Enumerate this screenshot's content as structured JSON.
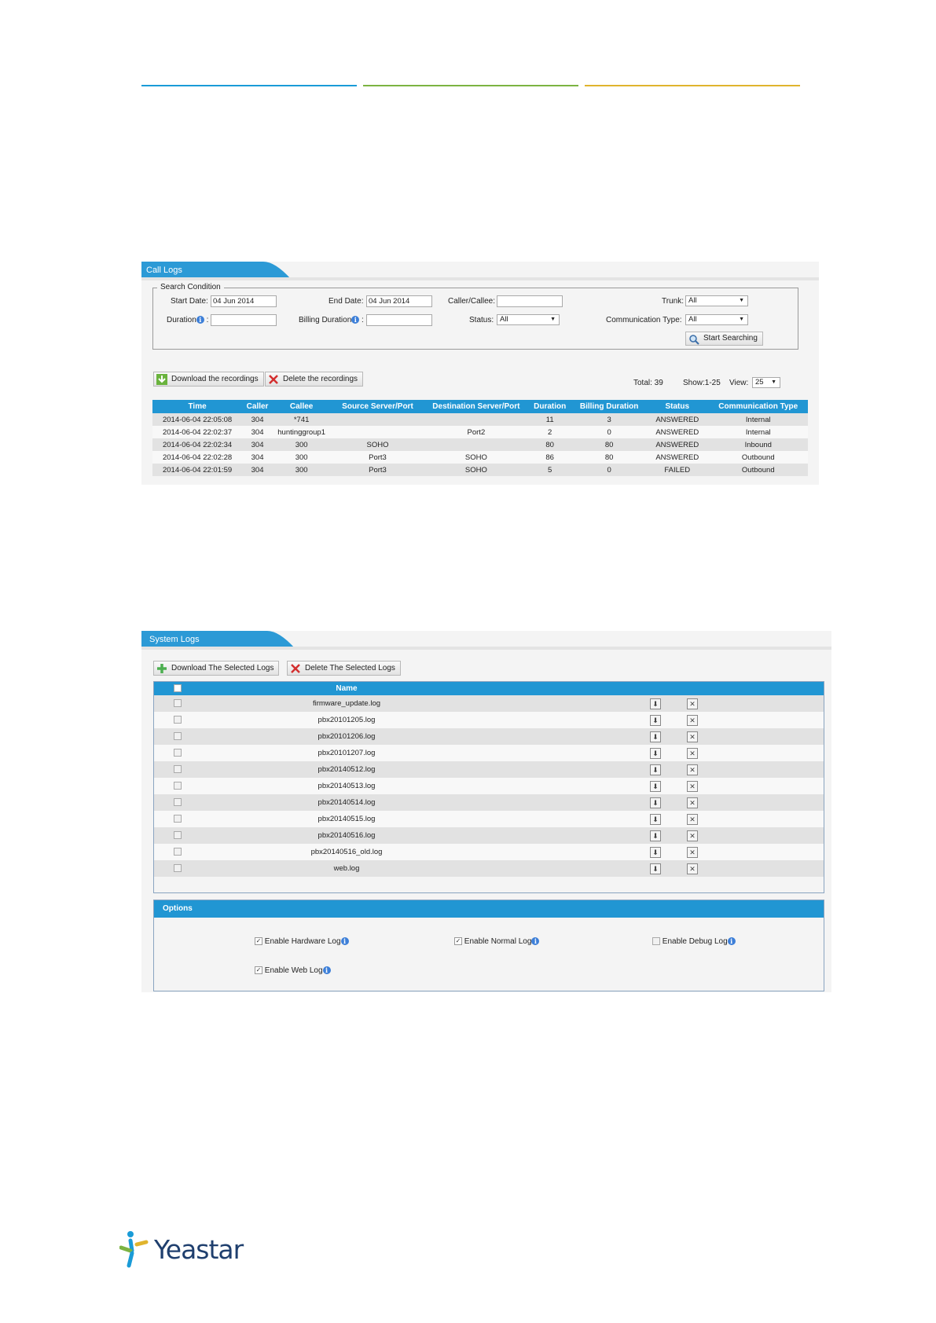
{
  "header": {
    "colors": [
      "#1a9bd7",
      "#7cb342",
      "#e0b42d"
    ]
  },
  "call_logs": {
    "tab_title": "Call Logs",
    "search": {
      "legend": "Search Condition",
      "start_date_label": "Start Date:",
      "start_date_value": "04 Jun 2014",
      "end_date_label": "End Date:",
      "end_date_value": "04 Jun 2014",
      "caller_callee_label": "Caller/Callee:",
      "caller_callee_value": "",
      "trunk_label": "Trunk:",
      "trunk_value": "All",
      "duration_label": "Duration",
      "duration_value": "",
      "billing_duration_label": "Billing Duration",
      "billing_duration_value": "",
      "status_label": "Status:",
      "status_value": "All",
      "comm_type_label": "Communication Type:",
      "comm_type_value": "All",
      "start_searching": "Start Searching"
    },
    "download_recordings": "Download the recordings",
    "delete_recordings": "Delete the recordings",
    "total": "Total: 39",
    "show": "Show:1-25",
    "view_label": "View:",
    "view_value": "25",
    "columns": [
      "Time",
      "Caller",
      "Callee",
      "Source Server/Port",
      "Destination Server/Port",
      "Duration",
      "Billing Duration",
      "Status",
      "Communication Type"
    ],
    "rows": [
      [
        "2014-06-04 22:05:08",
        "304",
        "*741",
        "",
        "",
        "11",
        "3",
        "ANSWERED",
        "Internal"
      ],
      [
        "2014-06-04 22:02:37",
        "304",
        "huntinggroup1",
        "",
        "Port2",
        "2",
        "0",
        "ANSWERED",
        "Internal"
      ],
      [
        "2014-06-04 22:02:34",
        "304",
        "300",
        "SOHO",
        "",
        "80",
        "80",
        "ANSWERED",
        "Inbound"
      ],
      [
        "2014-06-04 22:02:28",
        "304",
        "300",
        "Port3",
        "SOHO",
        "86",
        "80",
        "ANSWERED",
        "Outbound"
      ],
      [
        "2014-06-04 22:01:59",
        "304",
        "300",
        "Port3",
        "SOHO",
        "5",
        "0",
        "FAILED",
        "Outbound"
      ]
    ]
  },
  "system_logs": {
    "tab_title": "System Logs",
    "download_selected": "Download The Selected Logs",
    "delete_selected": "Delete The Selected Logs",
    "name_header": "Name",
    "files": [
      "firmware_update.log",
      "pbx20101205.log",
      "pbx20101206.log",
      "pbx20101207.log",
      "pbx20140512.log",
      "pbx20140513.log",
      "pbx20140514.log",
      "pbx20140515.log",
      "pbx20140516.log",
      "pbx20140516_old.log",
      "web.log"
    ],
    "options_title": "Options",
    "options": {
      "hardware": {
        "label": "Enable Hardware Log",
        "checked": true
      },
      "normal": {
        "label": "Enable Normal Log",
        "checked": true
      },
      "debug": {
        "label": "Enable Debug Log",
        "checked": false
      },
      "web": {
        "label": "Enable Web Log",
        "checked": true
      }
    }
  },
  "footer": {
    "brand": "Yeastar"
  }
}
